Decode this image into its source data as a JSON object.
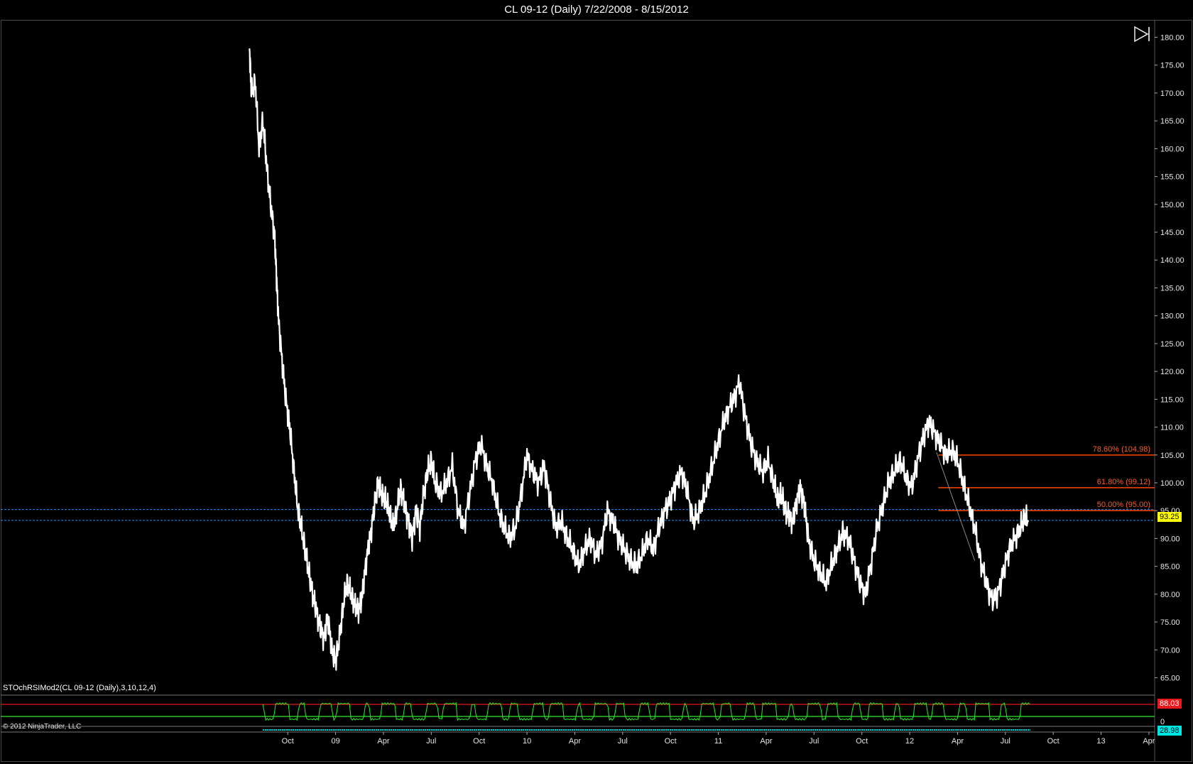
{
  "window": {
    "title": "CL 09-12 (Daily)  7/22/2008 - 8/15/2012"
  },
  "colors": {
    "background": "#000000",
    "price_line": "#ffffff",
    "fib_line": "#ff4500",
    "fib_text": "#ff5a28",
    "hline": "#1e90ff",
    "osc_line": "#2ee82e",
    "osc_upper": "#e5191e",
    "osc_lower": "#2ee82e",
    "badge_price": "#ffff00",
    "badge_osc": "#e5191e",
    "badge_vol": "#00e6e6"
  },
  "icons": {
    "play_end": "skip-to-end-icon"
  },
  "indicator": {
    "label": "STOchRSIMod2(CL 09-12 (Daily),3,10,12,4)",
    "upper_value": "88.03",
    "zero_label": "0",
    "volume_value": "28.98"
  },
  "footer": {
    "copyright": "© 2012 NinjaTrader, LLC"
  },
  "chart_data": {
    "type": "line",
    "title": "CL 09-12 (Daily)  7/22/2008 - 8/15/2012",
    "y_ticks": [
      "65.00",
      "70.00",
      "75.00",
      "80.00",
      "85.00",
      "90.00",
      "95.00",
      "100.00",
      "105.00",
      "110.00",
      "115.00",
      "120.00",
      "125.00",
      "130.00",
      "135.00",
      "140.00",
      "145.00",
      "150.00",
      "155.00",
      "160.00",
      "165.00",
      "170.00",
      "175.00",
      "180.00"
    ],
    "ylim": [
      62,
      183
    ],
    "x_ticks": [
      "Oct",
      "09",
      "Apr",
      "Jul",
      "Oct",
      "10",
      "Apr",
      "Jul",
      "Oct",
      "11",
      "Apr",
      "Jul",
      "Oct",
      "12",
      "Apr",
      "Jul",
      "Oct",
      "13",
      "Apr"
    ],
    "x_tick_months": [
      2008.75,
      2009.0,
      2009.25,
      2009.5,
      2009.75,
      2010.0,
      2010.25,
      2010.5,
      2010.75,
      2011.0,
      2011.25,
      2011.5,
      2011.75,
      2012.0,
      2012.25,
      2012.5,
      2012.75,
      2013.0,
      2013.25
    ],
    "xlim": [
      2007.25,
      2013.28
    ],
    "last_price": "93.25",
    "series": [
      {
        "x": [
          2008.55,
          2008.56,
          2008.58,
          2008.6,
          2008.62,
          2008.64,
          2008.66,
          2008.68,
          2008.69,
          2008.7,
          2008.72,
          2008.74,
          2008.76,
          2008.78,
          2008.8,
          2008.82,
          2008.84,
          2008.86,
          2008.88,
          2008.9,
          2008.92,
          2008.94,
          2008.96,
          2008.98,
          2009.0,
          2009.02,
          2009.04,
          2009.06,
          2009.08,
          2009.1,
          2009.12,
          2009.14,
          2009.16,
          2009.18,
          2009.2,
          2009.22,
          2009.24,
          2009.26,
          2009.28,
          2009.3,
          2009.32,
          2009.34,
          2009.36,
          2009.38,
          2009.4,
          2009.42,
          2009.44,
          2009.46,
          2009.48,
          2009.5,
          2009.52,
          2009.55,
          2009.58,
          2009.61,
          2009.64,
          2009.67,
          2009.7,
          2009.73,
          2009.76,
          2009.79,
          2009.82,
          2009.85,
          2009.88,
          2009.91,
          2009.94,
          2009.97,
          2010.0,
          2010.03,
          2010.06,
          2010.09,
          2010.12,
          2010.15,
          2010.18,
          2010.21,
          2010.24,
          2010.27,
          2010.3,
          2010.33,
          2010.36,
          2010.39,
          2010.42,
          2010.45,
          2010.48,
          2010.51,
          2010.54,
          2010.57,
          2010.6,
          2010.63,
          2010.66,
          2010.69,
          2010.72,
          2010.75,
          2010.78,
          2010.81,
          2010.84,
          2010.87,
          2010.9,
          2010.93,
          2010.96,
          2010.99,
          2011.02,
          2011.05,
          2011.08,
          2011.11,
          2011.14,
          2011.17,
          2011.2,
          2011.23,
          2011.26,
          2011.29,
          2011.31,
          2011.33,
          2011.35,
          2011.37,
          2011.39,
          2011.41,
          2011.43,
          2011.45,
          2011.47,
          2011.5,
          2011.53,
          2011.56,
          2011.59,
          2011.62,
          2011.65,
          2011.68,
          2011.71,
          2011.74,
          2011.77,
          2011.8,
          2011.83,
          2011.86,
          2011.89,
          2011.92,
          2011.95,
          2011.98,
          2012.01,
          2012.04,
          2012.07,
          2012.1,
          2012.13,
          2012.16,
          2012.19,
          2012.22,
          2012.25,
          2012.28,
          2012.31,
          2012.34,
          2012.37,
          2012.4,
          2012.43,
          2012.46,
          2012.49,
          2012.52,
          2012.55,
          2012.58,
          2012.6,
          2012.62
        ],
        "y": [
          178,
          170,
          172,
          160,
          165,
          157,
          150,
          145,
          138,
          130,
          122,
          115,
          110,
          103,
          96,
          92,
          88,
          84,
          80,
          77,
          74,
          72,
          76,
          70,
          68,
          72,
          78,
          82,
          80,
          78,
          77,
          80,
          86,
          90,
          95,
          100,
          98,
          97,
          95,
          92,
          95,
          99,
          96,
          93,
          90,
          95,
          92,
          98,
          102,
          104,
          100,
          98,
          100,
          103,
          95,
          92,
          98,
          104,
          107,
          103,
          100,
          95,
          92,
          90,
          92,
          98,
          105,
          102,
          100,
          103,
          97,
          92,
          93,
          90,
          88,
          85,
          88,
          90,
          87,
          89,
          95,
          93,
          90,
          88,
          86,
          85,
          87,
          90,
          88,
          92,
          95,
          97,
          100,
          102,
          98,
          93,
          95,
          98,
          102,
          106,
          110,
          113,
          115,
          118,
          112,
          107,
          104,
          102,
          104,
          100,
          97,
          98,
          95,
          94,
          93,
          97,
          99,
          96,
          90,
          86,
          84,
          82,
          85,
          88,
          91,
          90,
          86,
          82,
          80,
          86,
          92,
          96,
          100,
          102,
          104,
          101,
          99,
          104,
          108,
          111,
          109,
          107,
          105,
          106,
          104,
          100,
          96,
          92,
          86,
          82,
          79,
          80,
          84,
          88,
          90,
          92,
          94,
          93
        ]
      }
    ],
    "fibonacci": [
      {
        "label": "78.60% (104.98)",
        "value": 104.98
      },
      {
        "label": "61.80% (99.12)",
        "value": 99.12
      },
      {
        "label": "50.00% (95.00)",
        "value": 95.0
      }
    ],
    "fib_x_start": 2012.15,
    "horizontal_lines": [
      95.2,
      93.25
    ],
    "trendline": {
      "x": [
        2012.14,
        2012.34
      ],
      "y": [
        105.5,
        86
      ]
    }
  }
}
